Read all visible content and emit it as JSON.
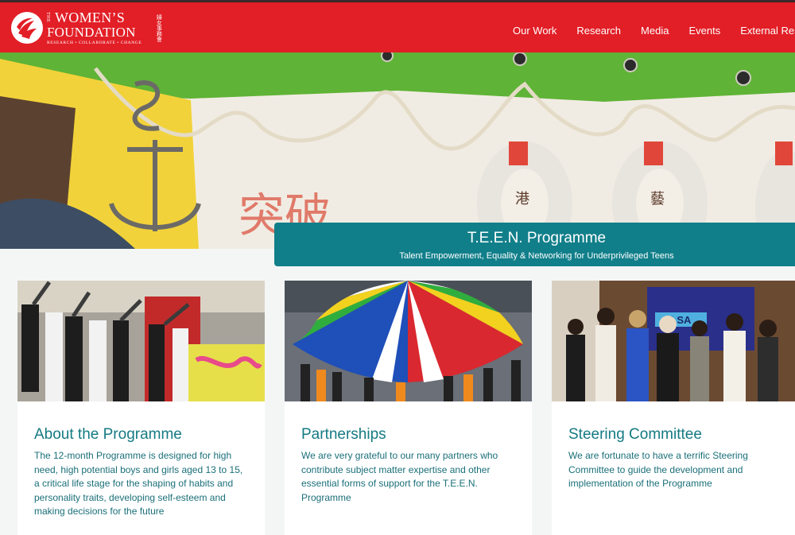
{
  "header": {
    "logo": {
      "the": "THE",
      "line1": "WOMEN’S",
      "line2": "FOUNDATION",
      "tagline": "RESEARCH • COLLABORATE • CHANGE",
      "chinese": "婦女事務會"
    },
    "nav": [
      "Our Work",
      "Research",
      "Media",
      "Events",
      "External Resources"
    ]
  },
  "banner": {
    "title": "T.E.E.N. Programme",
    "subtitle": "Talent Empowerment, Equality & Networking for Underprivileged Teens"
  },
  "cards": [
    {
      "title": "About the Programme",
      "body": "The 12-month Programme is designed for high need, high potential boys and girls aged 13 to 15, a critical life stage for the shaping of habits and personality traits, developing self-esteem and making decisions for the future"
    },
    {
      "title": "Partnerships",
      "body": "We are very grateful to our many partners who contribute subject matter expertise and other essential forms of support for the T.E.E.N. Programme"
    },
    {
      "title": "Steering Committee",
      "body": "We are fortunate to have a terrific Steering Committee to guide the development and implementation of the Programme"
    }
  ],
  "photo_text": {
    "hero_chinese": "突破",
    "lifebuoy_chars": [
      "港",
      "藝"
    ],
    "clsa_sign": "CLSA"
  },
  "colors": {
    "header_red": "#e21e26",
    "banner_teal": "#117f8a",
    "heading_teal": "#157a82",
    "body_teal": "#1a6f79"
  }
}
